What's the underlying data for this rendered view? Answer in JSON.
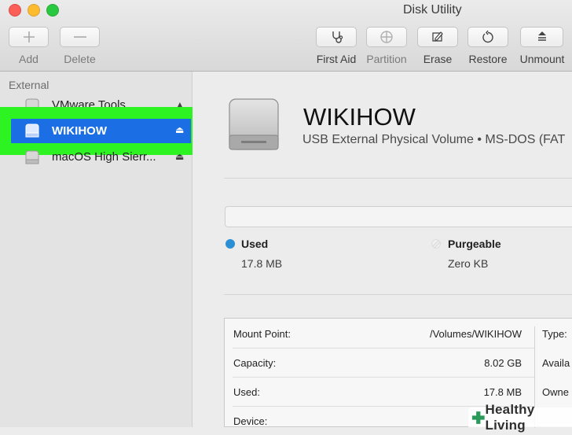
{
  "window": {
    "title": "Disk Utility"
  },
  "toolbar": {
    "buttons": [
      {
        "label": "Add",
        "icon": "plus-icon",
        "enabled": false
      },
      {
        "label": "Delete",
        "icon": "minus-icon",
        "enabled": false
      },
      {
        "label": "First Aid",
        "icon": "stethoscope-icon",
        "enabled": true
      },
      {
        "label": "Partition",
        "icon": "partition-icon",
        "enabled": false
      },
      {
        "label": "Erase",
        "icon": "erase-icon",
        "enabled": true
      },
      {
        "label": "Restore",
        "icon": "restore-icon",
        "enabled": true
      },
      {
        "label": "Unmount",
        "icon": "eject-icon",
        "enabled": true
      }
    ]
  },
  "sidebar": {
    "heading": "External",
    "items": [
      {
        "label": "VMware Tools",
        "icon": "disk-icon",
        "eject": "▲"
      },
      {
        "label": "WIKIHOW",
        "icon": "disk-icon",
        "eject": "⏏",
        "selected": true
      },
      {
        "label": "macOS High Sierr...",
        "icon": "disk-icon",
        "eject": "⏏"
      }
    ]
  },
  "main": {
    "volume_name": "WIKIHOW",
    "volume_desc": "USB External Physical Volume • MS-DOS (FAT",
    "usage": {
      "used_label": "Used",
      "used_value": "17.8 MB",
      "used_color": "#2b8fd6",
      "purgeable_label": "Purgeable",
      "purgeable_value": "Zero KB"
    },
    "info": {
      "left": [
        {
          "key": "Mount Point:",
          "value": "/Volumes/WIKIHOW"
        },
        {
          "key": "Capacity:",
          "value": "8.02 GB"
        },
        {
          "key": "Used:",
          "value": "17.8 MB"
        },
        {
          "key": "Device:",
          "value": ""
        }
      ],
      "right": [
        {
          "key": "Type:"
        },
        {
          "key": "Availa"
        },
        {
          "key": "Owne"
        }
      ]
    }
  },
  "watermark": {
    "text": "Healthy Living"
  },
  "colors": {
    "selection": "#1c6ee4",
    "highlight": "#2ef322",
    "watermark_plus": "#2a9a5a"
  }
}
